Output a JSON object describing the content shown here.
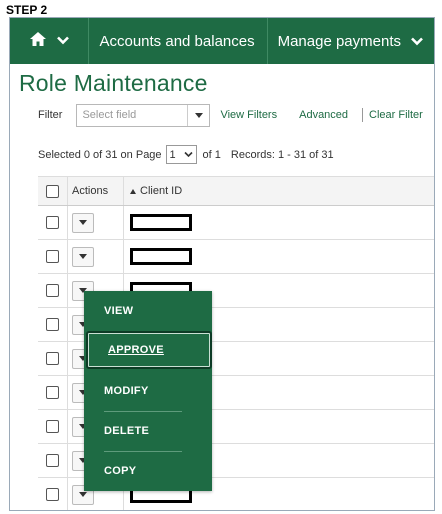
{
  "step_label": "STEP 2",
  "nav": {
    "items": [
      {
        "label": "Accounts and balances",
        "has_chevron": false
      },
      {
        "label": "Manage payments",
        "has_chevron": true
      }
    ]
  },
  "page_title": "Role Maintenance",
  "filter": {
    "label": "Filter",
    "placeholder": "Select field",
    "links": [
      "View Filters",
      "Advanced",
      "Clear Filter"
    ]
  },
  "pagination": {
    "selected_text": "Selected 0 of 31 on Page",
    "page_value": "1",
    "of_text": "of 1",
    "records_text": "Records: 1 - 31 of 31"
  },
  "table": {
    "headers": {
      "actions": "Actions",
      "client_id": "Client ID"
    },
    "row_count": 9
  },
  "menu": {
    "items": [
      "VIEW",
      "APPROVE",
      "MODIFY",
      "DELETE",
      "COPY"
    ],
    "active": "APPROVE"
  },
  "colors": {
    "brand_green": "#1e6b44",
    "dark_green": "#0d3b26"
  }
}
